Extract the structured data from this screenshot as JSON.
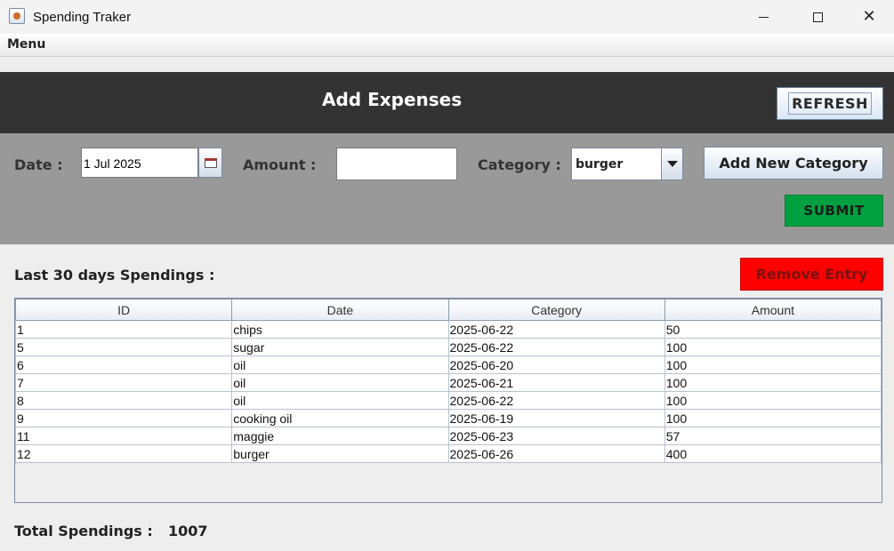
{
  "window": {
    "title": "Spending Traker",
    "minimize": "minimize",
    "maximize": "maximize",
    "close": "close"
  },
  "menu": {
    "label": "Menu"
  },
  "header": {
    "title": "Add Expenses",
    "refresh_label": "REFRESH"
  },
  "form": {
    "date_label": "Date :",
    "date_value": "1 Jul 2025",
    "amount_label": "Amount :",
    "amount_value": "",
    "category_label": "Category :",
    "category_selected": "burger",
    "add_category_label": "Add New Category",
    "submit_label": "SUBMIT"
  },
  "table_section": {
    "title": "Last 30 days Spendings :",
    "remove_label": "Remove Entry",
    "columns": [
      "ID",
      "Date",
      "Category",
      "Amount"
    ],
    "rows": [
      [
        "1",
        "chips",
        "2025-06-22",
        "50"
      ],
      [
        "5",
        "sugar",
        "2025-06-22",
        "100"
      ],
      [
        "6",
        "oil",
        "2025-06-20",
        "100"
      ],
      [
        "7",
        "oil",
        "2025-06-21",
        "100"
      ],
      [
        "8",
        "oil",
        "2025-06-22",
        "100"
      ],
      [
        "9",
        "cooking oil",
        "2025-06-19",
        "100"
      ],
      [
        "11",
        "maggie",
        "2025-06-23",
        "57"
      ],
      [
        "12",
        "burger",
        "2025-06-26",
        "400"
      ]
    ]
  },
  "footer": {
    "total_label": "Total Spendings :",
    "total_value": "1007"
  },
  "colors": {
    "header_bg": "#333333",
    "form_bg": "#999999",
    "submit": "#00a040",
    "remove": "#ff0000"
  }
}
